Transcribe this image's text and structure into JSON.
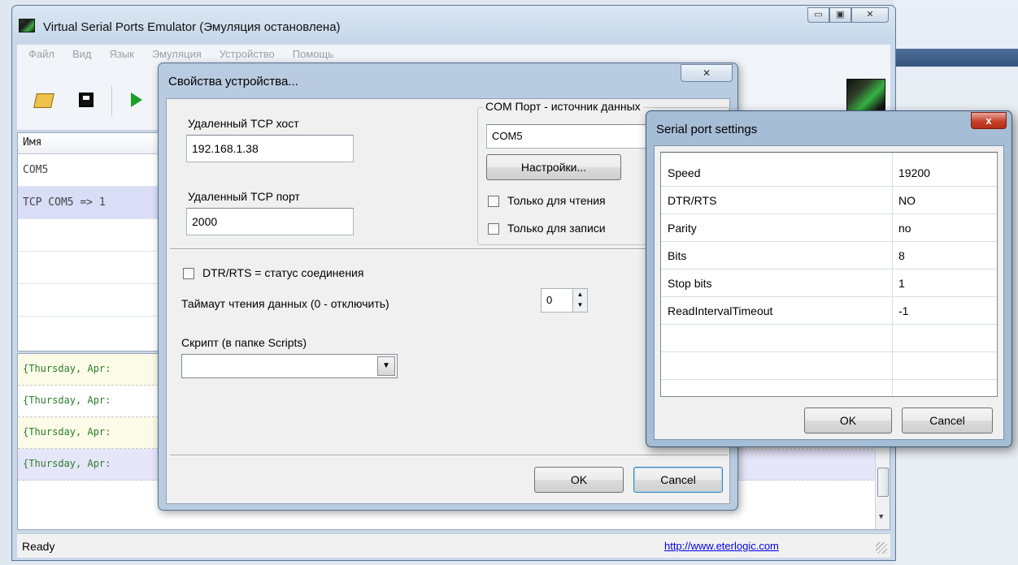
{
  "main_window": {
    "title": "Virtual Serial Ports Emulator (Эмуляция остановлена)",
    "caption_min": "▭",
    "caption_max": "▣",
    "caption_close": "✕",
    "menu": [
      "Файл",
      "Вид",
      "Язык",
      "Эмуляция",
      "Устройство",
      "Помощь"
    ],
    "list_header": "Имя",
    "devices": [
      "COM5",
      "TCP COM5 => 1"
    ],
    "log_lines": [
      "{Thursday, Apr:",
      "{Thursday, Apr:",
      "{Thursday, Apr:",
      "{Thursday, Apr:"
    ],
    "status": "Ready",
    "url": "http://www.eterlogic.com"
  },
  "device_dialog": {
    "title": "Свойства устройства...",
    "close": "✕",
    "remote_host_label": "Удаленный TCP хост",
    "remote_host_value": "192.168.1.38",
    "remote_port_label": "Удаленный TCP порт",
    "remote_port_value": "2000",
    "com_group_label": "COM Порт - источник данных",
    "com_value": "COM5",
    "settings_button": "Настройки...",
    "read_only_label": "Только для чтения",
    "write_only_label": "Только для записи",
    "dtr_rts_label": "DTR/RTS = статус соединения",
    "timeout_label": "Таймаут чтения данных (0 - отключить)",
    "timeout_value": "0",
    "script_label": "Скрипт (в папке Scripts)",
    "ok": "OK",
    "cancel": "Cancel"
  },
  "serial_dialog": {
    "title": "Serial port settings",
    "close": "x",
    "rows": [
      {
        "key": "Speed",
        "value": "19200"
      },
      {
        "key": "DTR/RTS",
        "value": "NO"
      },
      {
        "key": "Parity",
        "value": "no"
      },
      {
        "key": "Bits",
        "value": "8"
      },
      {
        "key": "Stop bits",
        "value": "1"
      },
      {
        "key": "ReadIntervalTimeout",
        "value": "-1"
      }
    ],
    "ok": "OK",
    "cancel": "Cancel"
  }
}
